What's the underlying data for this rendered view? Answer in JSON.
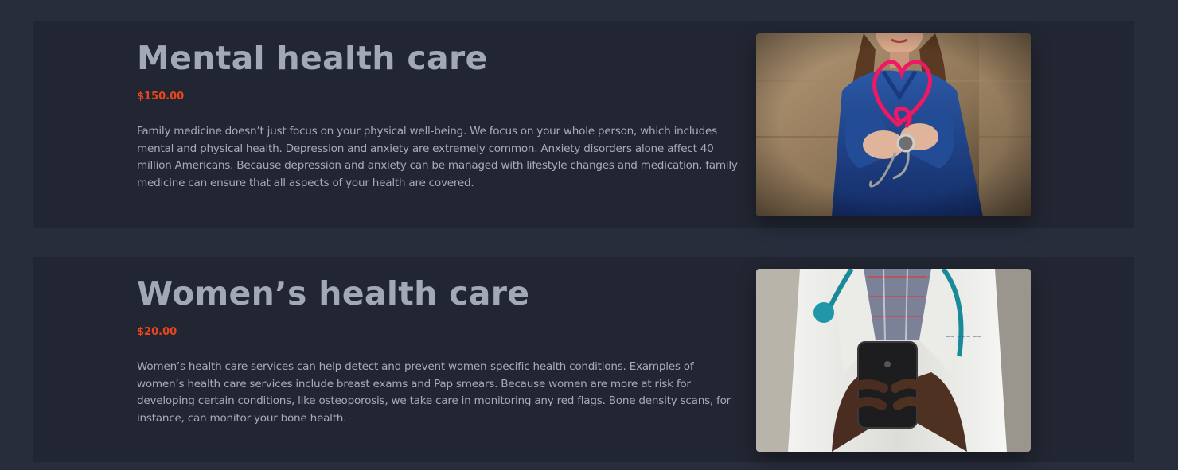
{
  "services": [
    {
      "title": "Mental health care",
      "price": "$150.00",
      "description": "Family medicine doesn’t just focus on your physical well-being. We focus on your whole person, which includes mental and physical health. Depression and anxiety are extremely common. Anxiety disorders alone affect 40 million Americans. Because depression and anxiety can be managed with lifestyle changes and medication, family medicine can ensure that all aspects of your health are covered.",
      "image": "doctor-holding-heart-shaped-stethoscope-photo"
    },
    {
      "title": "Women’s health care",
      "price": "$20.00",
      "description": "Women’s health care services can help detect and prevent women-specific health conditions. Examples of women’s health care services include breast exams and Pap smears. Because women are more at risk for developing certain conditions, like osteoporosis, we take care in monitoring any red flags. Bone density scans, for instance, can monitor your bone health.",
      "image": "doctor-holding-smartphone-photo"
    }
  ],
  "colors": {
    "page_background": "#282d3c",
    "card_background": "#222632",
    "title": "#a3a8b6",
    "price": "#e8461c",
    "body_text": "#a7abb7"
  }
}
